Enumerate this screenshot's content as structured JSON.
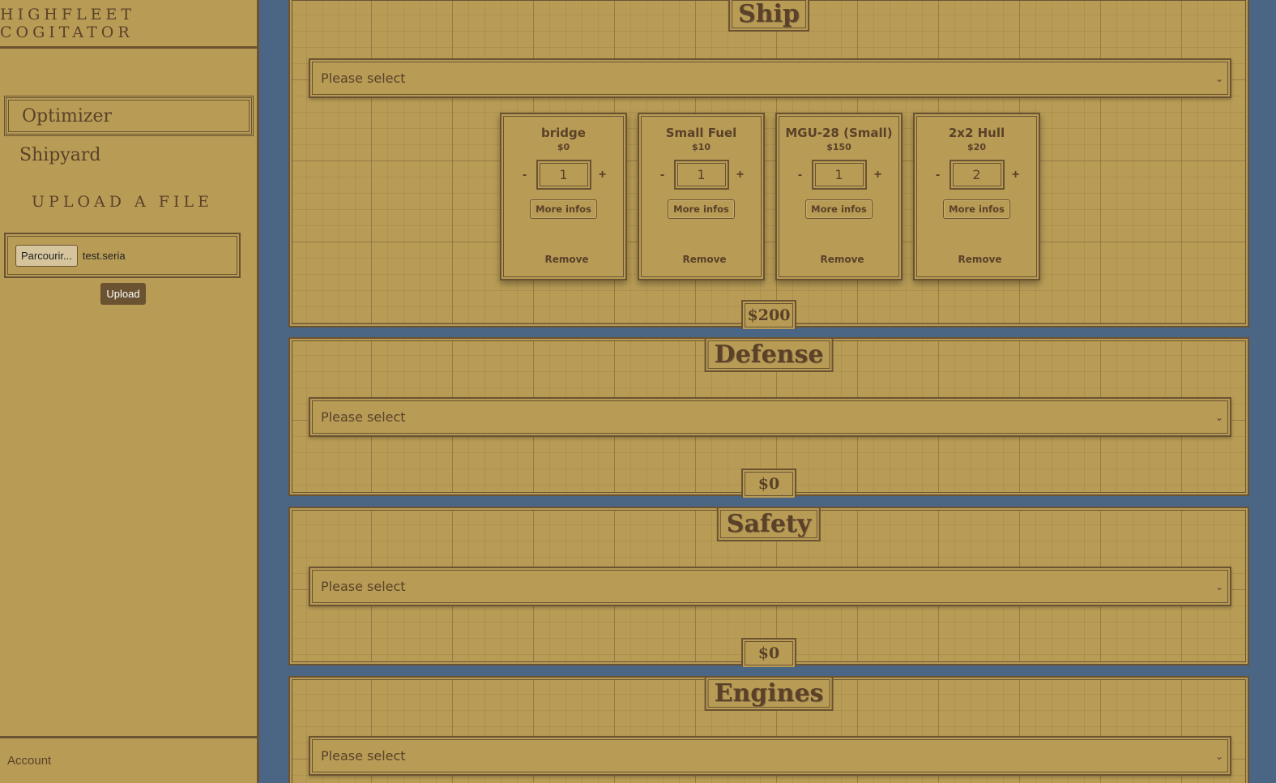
{
  "sidebar": {
    "brand": "HIGHFLEET COGITATOR",
    "nav": [
      {
        "label": "Optimizer",
        "active": true
      },
      {
        "label": "Shipyard",
        "active": false
      }
    ],
    "upload": {
      "title": "UPLOAD A FILE",
      "browse_label": "Parcourir...",
      "file_name": "test.seria",
      "upload_label": "Upload"
    },
    "account_label": "Account"
  },
  "sections": [
    {
      "title": "Ship",
      "select_placeholder": "Please select",
      "total": "$200",
      "items": [
        {
          "name": "bridge",
          "price": "$0",
          "qty": "1",
          "more": "More infos",
          "remove": "Remove"
        },
        {
          "name": "Small Fuel",
          "price": "$10",
          "qty": "1",
          "more": "More infos",
          "remove": "Remove"
        },
        {
          "name": "MGU-28 (Small)",
          "price": "$150",
          "qty": "1",
          "more": "More infos",
          "remove": "Remove"
        },
        {
          "name": "2x2 Hull",
          "price": "$20",
          "qty": "2",
          "more": "More infos",
          "remove": "Remove"
        }
      ]
    },
    {
      "title": "Defense",
      "select_placeholder": "Please select",
      "total": "$0"
    },
    {
      "title": "Safety",
      "select_placeholder": "Please select",
      "total": "$0"
    },
    {
      "title": "Engines",
      "select_placeholder": "Please select"
    }
  ],
  "qty_controls": {
    "minus": "-",
    "plus": "+"
  },
  "icons": {
    "select": "chevron-down-icon"
  },
  "colors": {
    "background": "#4b6584",
    "parchment": "#b89c56",
    "ink": "#5a4128"
  }
}
